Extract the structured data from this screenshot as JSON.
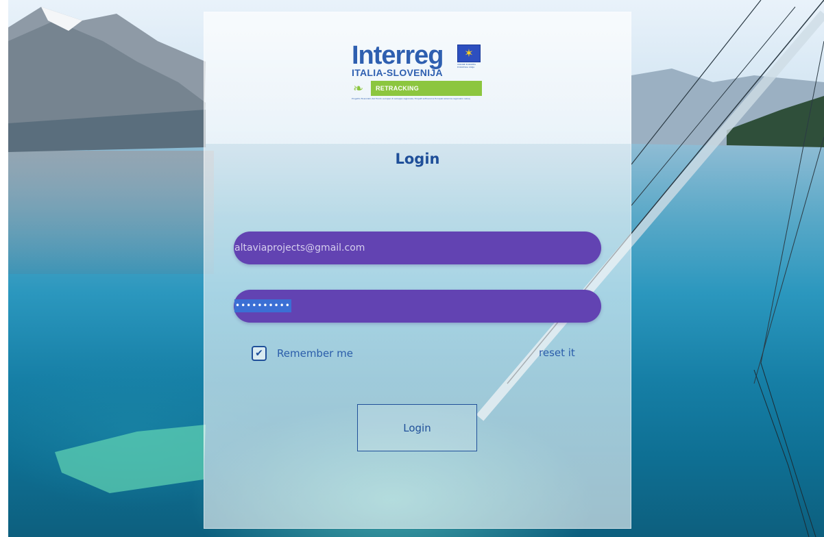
{
  "logo": {
    "wordmark": "Interreg",
    "region": "ITALIA-SLOVENIJA",
    "project": "RETRACKING",
    "eu_caption": "UNIONE EUROPEA EVROPSKA UNIJA",
    "fine_print": "Progetto finanziato dal Fondo europeo di sviluppo regionale / Projekt sofinancira Evropski sklad za regionalni razvoj",
    "flag_icon": "eu-flag-icon",
    "leaf_icon": "leaf-icon"
  },
  "form": {
    "title": "Login",
    "email_value": "altaviaprojects@gmail.com",
    "password_mask": "••••••••••",
    "remember_label": "Remember me",
    "remember_checked": true,
    "reset_label": "reset it",
    "submit_label": "Login"
  },
  "colors": {
    "field_bg": "#6243b2",
    "accent": "#1f4f99",
    "badge_green": "#8cc63f"
  }
}
